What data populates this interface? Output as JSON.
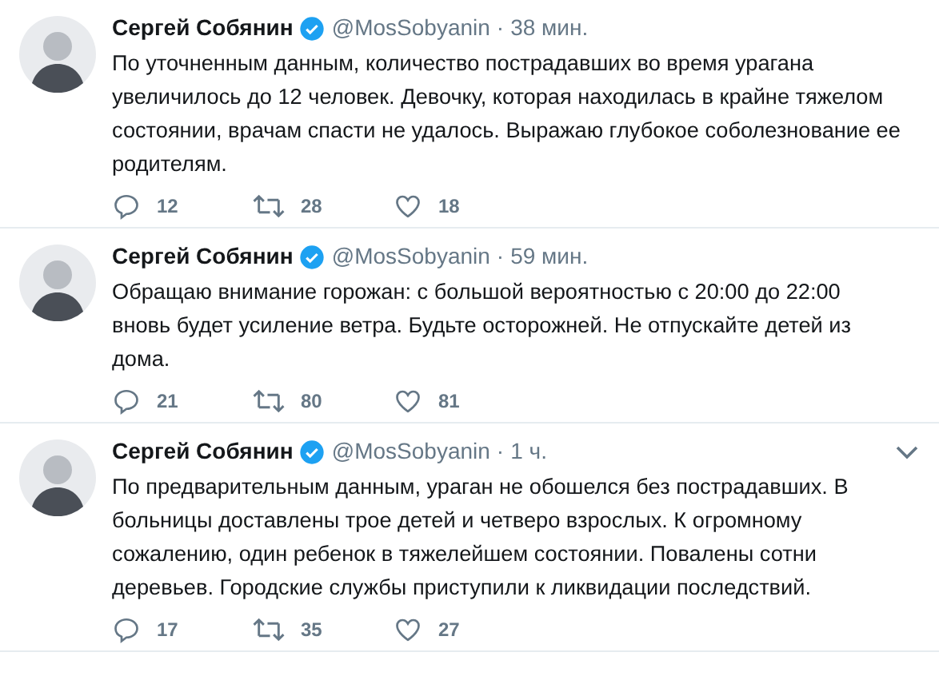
{
  "tweets": [
    {
      "name": "Сергей Собянин",
      "verified": true,
      "handle": "@MosSobyanin",
      "separator": "·",
      "time": "38 мин.",
      "menu_caret": false,
      "lines": [
        "По уточненным данным, количество пострадавших во время урагана",
        "увеличилось до 12 человек. Девочку, которая находилась в крайне тяжелом",
        "состоянии, врачам спасти не удалось. Выражаю глубокое соболезнование ее",
        "родителям."
      ],
      "replies": "12",
      "retweets": "28",
      "likes": "18"
    },
    {
      "name": "Сергей Собянин",
      "verified": true,
      "handle": "@MosSobyanin",
      "separator": "·",
      "time": "59 мин.",
      "menu_caret": false,
      "lines": [
        "Обращаю внимание горожан: с большой вероятностью с 20:00 до 22:00",
        "вновь будет усиление ветра. Будьте осторожней. Не отпускайте детей из",
        "дома."
      ],
      "replies": "21",
      "retweets": "80",
      "likes": "81"
    },
    {
      "name": "Сергей Собянин",
      "verified": true,
      "handle": "@MosSobyanin",
      "separator": "·",
      "time": "1 ч.",
      "menu_caret": true,
      "lines": [
        "По предварительным данным, ураган не обошелся без пострадавших. В",
        "больницы доставлены трое детей и четверо взрослых. К огромному",
        "сожалению, один ребенок в тяжелейшем состоянии. Повалены сотни",
        "деревьев. Городские службы приступили к ликвидации последствий."
      ],
      "replies": "17",
      "retweets": "35",
      "likes": "27"
    }
  ]
}
